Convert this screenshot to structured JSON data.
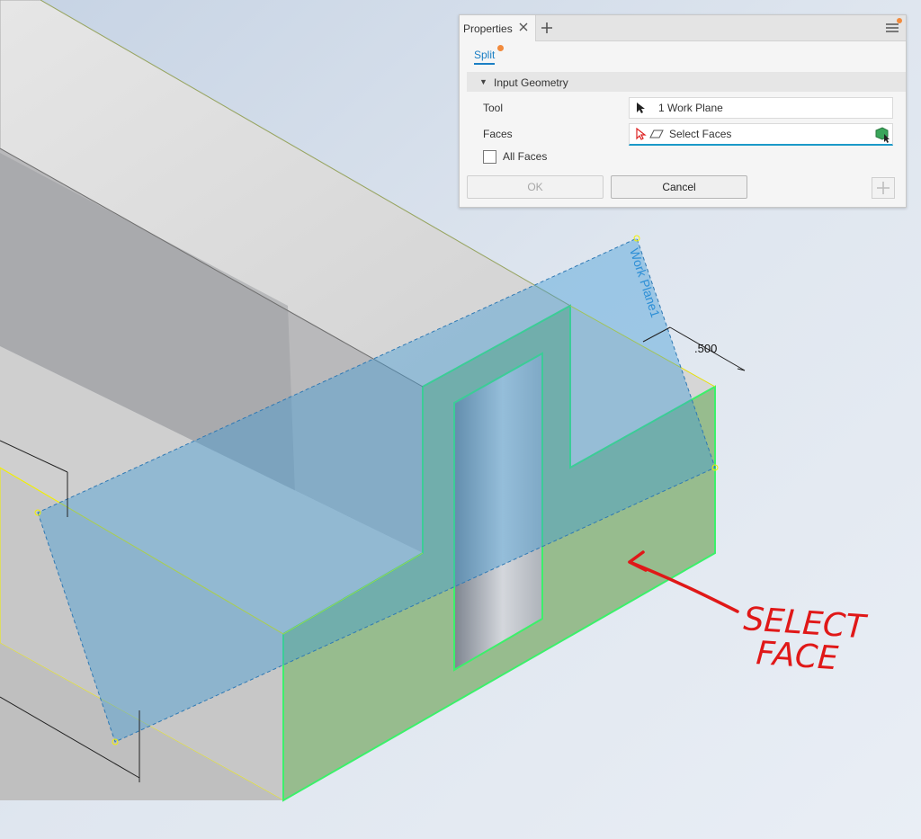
{
  "panel": {
    "tab_label": "Properties",
    "command": "Split",
    "section_title": "Input Geometry",
    "rows": [
      {
        "label": "Tool",
        "value": "1 Work Plane"
      },
      {
        "label": "Faces",
        "value": "Select Faces"
      }
    ],
    "checkbox_label": "All Faces",
    "checkbox_checked": false,
    "ok_label": "OK",
    "cancel_label": "Cancel"
  },
  "viewport": {
    "plane_label": "Work Plane1",
    "dimension_label": ".500",
    "annotation_line1": "SELECT",
    "annotation_line2": "FACE"
  },
  "colors": {
    "accent": "#1b7fc4",
    "face_highlight": "#3cf06a",
    "work_plane": "#3d9ad6",
    "annotation": "#e01818",
    "notify_dot": "#f28a3c"
  },
  "icons": [
    "close-icon",
    "plus-icon",
    "hamburger-menu-icon",
    "collapse-arrow-icon",
    "cursor-arrow-icon",
    "select-face-icon",
    "face-filter-icon",
    "add-icon"
  ]
}
